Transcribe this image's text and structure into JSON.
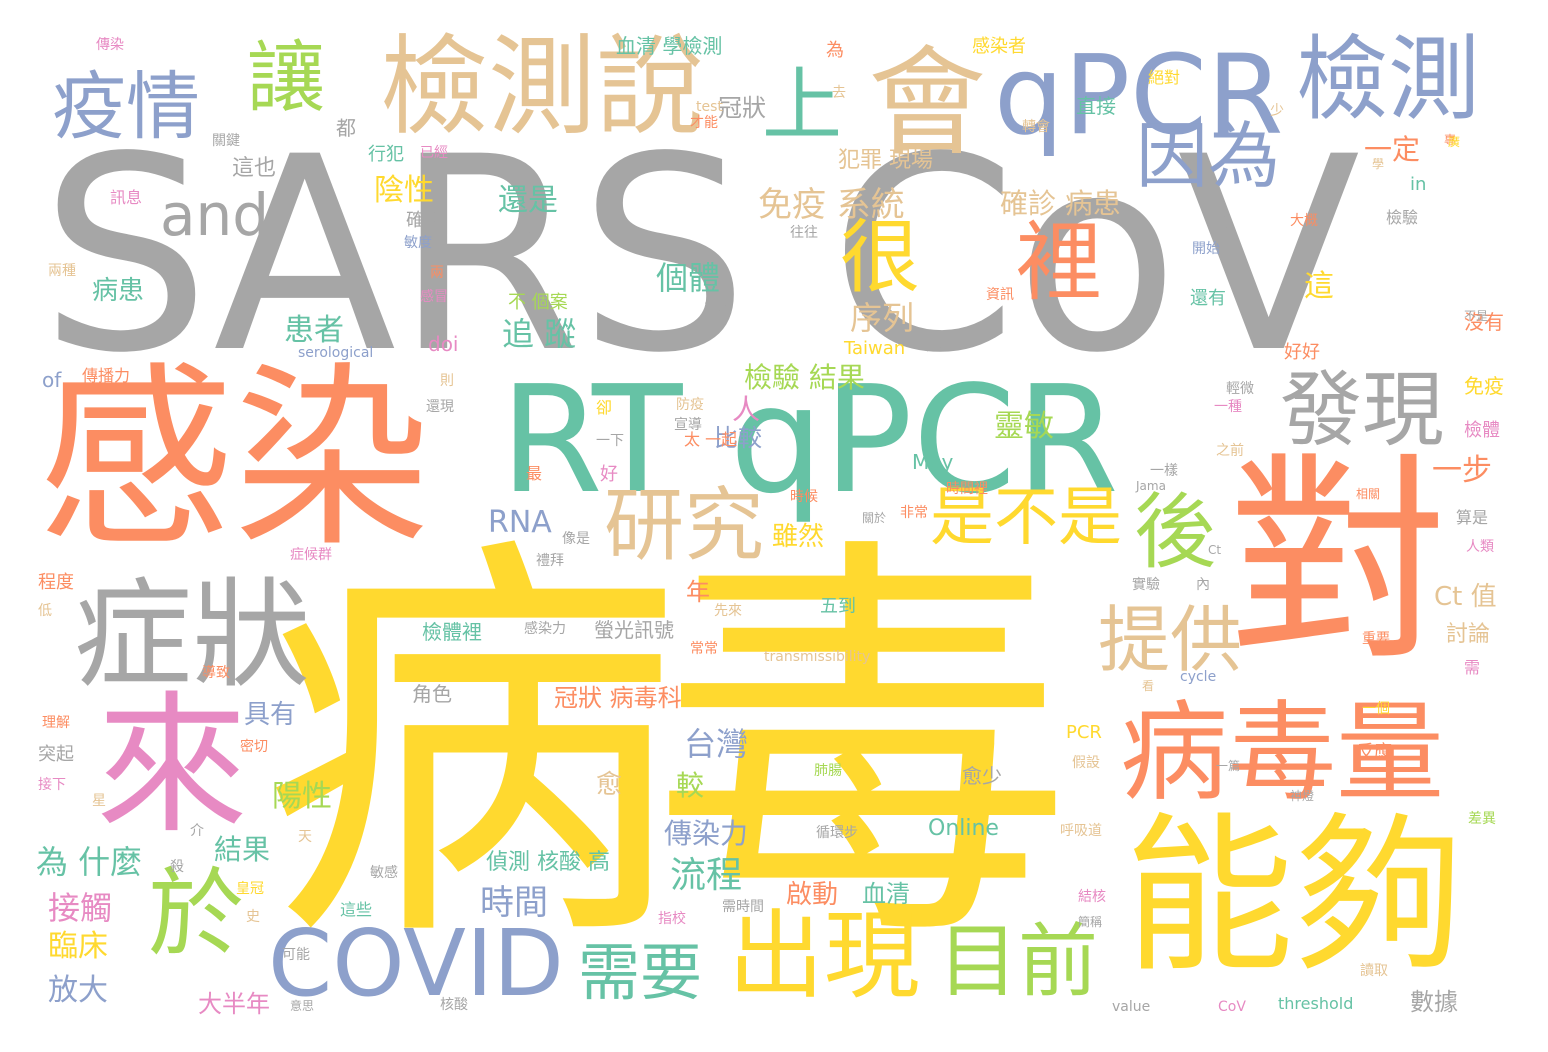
{
  "palette": {
    "grey": "#a6a6a6",
    "yellow": "#ffd92f",
    "orange": "#fc8d62",
    "teal": "#66c2a5",
    "blue": "#8da0cb",
    "pink": "#e78ac3",
    "green": "#a6d854",
    "tan": "#e5c494"
  },
  "words": {
    "sarscov": "SARS CoV",
    "bingdu": "病毒",
    "ganran": "感染",
    "rtqpcr": "RT qPCR",
    "dui": "對",
    "lai": "來",
    "nenggou": "能夠",
    "zhengzhuang": "症狀",
    "bingduliang": "病毒量",
    "fa_xian": "發現",
    "qpcr_top": "qPCR",
    "jiance_top": "檢測說",
    "hui": "會",
    "jiance_right": "檢測",
    "yiqing": "疫情",
    "rang": "讓",
    "shang": "上",
    "yinwei": "因為",
    "li": "裡",
    "hen": "很",
    "and": "and",
    "covid": "COVID",
    "chuxian": "出現",
    "yu": "於",
    "yanjiu": "研究",
    "hou": "後",
    "mubiao": "目前",
    "tigong": "提供",
    "shibushi": "是不是",
    "xuyao": "需要",
    "rna": "RNA",
    "shijian": "時間",
    "liucheng": "流程",
    "chuanranli": "傳染力",
    "taiwan": "台灣",
    "mianyi": "免疫 系統",
    "xulie": "序列",
    "geti": "個體",
    "zhuizong": "追 蹤",
    "huanzhe": "患者",
    "bingren": "病患",
    "yinxing": "陰性",
    "yangxing": "陽性",
    "weishenme": "為 什麼",
    "jiechu": "接觸",
    "linchuang": "臨床",
    "fangda": "放大",
    "jieguo_l": "結果",
    "juyou": "具有",
    "dabannian": "大半年",
    "haishi": "還是",
    "jianyan_jieguo": "檢驗 結果",
    "ren": "人",
    "bijiao": "比較",
    "lingmin": "靈敏",
    "yiding": "一定",
    "yibu": "一步",
    "quezhen": "確診 病患",
    "fanzui": "犯罪 現場",
    "guanzhuang": "冠狀",
    "zhe": "這",
    "ct_zhi": "Ct 值",
    "taolun": "討論",
    "suiran": "雖然",
    "qidong": "啟動",
    "xueqing": "血清",
    "zhence": "偵測 核酸 高",
    "guanzhuang_bdk": "冠狀 病毒科",
    "jiao": "較",
    "yu_heal": "愈",
    "nian": "年",
    "shuju": "數據",
    "online": "Online",
    "may": "May",
    "pcr": "PCR",
    "of": "of",
    "doi": "doi",
    "in": "in",
    "taiwan_en": "Taiwan",
    "cyc": "cycle",
    "transmissibility": "transmissibility",
    "threshold": "threshold",
    "cov_small": "CoV",
    "value": "value",
    "jama": "Jama",
    "ct_small": "Ct",
    "serological": "serological",
    "test": "test",
    "chuanran": "傳染",
    "xueqing_top": "血清 學檢測",
    "ganranzhe": "感染者",
    "wei_top": "為",
    "juedui": "絕對",
    "zhijie": "直接",
    "dou": "都",
    "zheye": "這也",
    "xingfan": "行犯",
    "yijing": "已經",
    "xunxi": "訊息",
    "quezhen2": "確診",
    "liangzhong": "兩種",
    "bingh": "病患",
    "bu_geanzi": "不 個案",
    "jiantili": "檢體裡",
    "ganranli": "感染力",
    "yingguang": "螢光訊號",
    "wudao": "五到",
    "jiaose": "角色",
    "yushao": "愈少",
    "zhexie": "這些",
    "keneng": "可能",
    "hesuan": "核酸",
    "yisi": "意思",
    "tuqi": "突起",
    "jiexia": "接下",
    "chengdu": "程度",
    "di": "低",
    "lijie": "理解",
    "zui": "最",
    "hao": "好",
    "yixia": "一下",
    "tai_yiqi": "太 一起",
    "yiyang": "一樣",
    "shihou": "時候",
    "kaishi": "開始",
    "haiyou": "還有",
    "jianyan": "檢驗",
    "dagai": "大概",
    "meiyou": "沒有",
    "haohao": "好好",
    "mianyi_r": "免疫",
    "jianti": "檢體",
    "suanshi": "算是",
    "fanying": "反應",
    "xunhuanbu": "循環步",
    "changchang": "常常",
    "xianlai": "先來",
    "wangwang": "往往",
    "fenxi": "分析",
    "buzu": "不是",
    "yizhong": "一種",
    "zhiqian": "之前",
    "xiangguan": "相關",
    "renlei": "人類",
    "zhongyao": "重要",
    "xu": "需",
    "yige": "一個",
    "jiashe": "假設",
    "huxidao": "呼吸道",
    "chayi": "差異",
    "duqu": "讀取",
    "shijianli": "時間裡",
    "feichang": "非常",
    "guanyu": "關於",
    "xiangshi": "像是",
    "libai": "禮拜",
    "zhenghouqun": "症候群",
    "shiyan": "實驗",
    "nei": "內",
    "zhibiao": "指校",
    "xushijian": "需時間",
    "jiehe": "結核",
    "mianbi": "面壁",
    "zhuan": "專",
    "guanjian": "關鍵",
    "misc_a": "去",
    "misc_b": "少",
    "misc_c": "才能",
    "misc_d": "轉會",
    "misc_e": "學",
    "misc_f": "大家",
    "misc_g": "正確",
    "misc_h": "兩",
    "misc_i": "感冒",
    "misc_j": "敏度",
    "misc_k": "資訊",
    "misc_l": "判斷",
    "misc_m": "防疫",
    "misc_n": "宣導",
    "misc_o": "傳播力",
    "misc_p": "則",
    "misc_q": "還現",
    "misc_r": "卻",
    "misc_s": "輕微",
    "misc_t": "導致",
    "misc_u": "密切",
    "misc_v": "介",
    "misc_w": "星",
    "misc_x": "殺",
    "misc_y": "史",
    "misc_z": "敏感",
    "misc_aa": "皇冠",
    "misc_ab": "天",
    "misc_ac": "看",
    "misc_ad": "一篇",
    "misc_ae": "肺腸",
    "misc_af": "神燈",
    "misc_ag": "簡稱",
    "misc_ah": "暖",
    "misc_ai": "廣"
  }
}
